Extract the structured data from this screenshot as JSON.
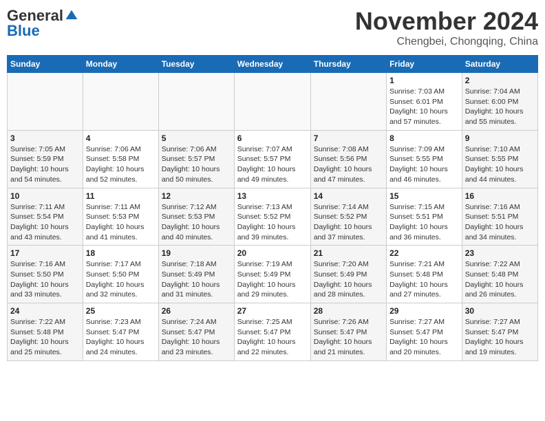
{
  "header": {
    "logo_general": "General",
    "logo_blue": "Blue",
    "month_title": "November 2024",
    "location": "Chengbei, Chongqing, China"
  },
  "weekdays": [
    "Sunday",
    "Monday",
    "Tuesday",
    "Wednesday",
    "Thursday",
    "Friday",
    "Saturday"
  ],
  "weeks": [
    {
      "days": [
        {
          "num": "",
          "info": ""
        },
        {
          "num": "",
          "info": ""
        },
        {
          "num": "",
          "info": ""
        },
        {
          "num": "",
          "info": ""
        },
        {
          "num": "",
          "info": ""
        },
        {
          "num": "1",
          "info": "Sunrise: 7:03 AM\nSunset: 6:01 PM\nDaylight: 10 hours and 57 minutes."
        },
        {
          "num": "2",
          "info": "Sunrise: 7:04 AM\nSunset: 6:00 PM\nDaylight: 10 hours and 55 minutes."
        }
      ]
    },
    {
      "days": [
        {
          "num": "3",
          "info": "Sunrise: 7:05 AM\nSunset: 5:59 PM\nDaylight: 10 hours and 54 minutes."
        },
        {
          "num": "4",
          "info": "Sunrise: 7:06 AM\nSunset: 5:58 PM\nDaylight: 10 hours and 52 minutes."
        },
        {
          "num": "5",
          "info": "Sunrise: 7:06 AM\nSunset: 5:57 PM\nDaylight: 10 hours and 50 minutes."
        },
        {
          "num": "6",
          "info": "Sunrise: 7:07 AM\nSunset: 5:57 PM\nDaylight: 10 hours and 49 minutes."
        },
        {
          "num": "7",
          "info": "Sunrise: 7:08 AM\nSunset: 5:56 PM\nDaylight: 10 hours and 47 minutes."
        },
        {
          "num": "8",
          "info": "Sunrise: 7:09 AM\nSunset: 5:55 PM\nDaylight: 10 hours and 46 minutes."
        },
        {
          "num": "9",
          "info": "Sunrise: 7:10 AM\nSunset: 5:55 PM\nDaylight: 10 hours and 44 minutes."
        }
      ]
    },
    {
      "days": [
        {
          "num": "10",
          "info": "Sunrise: 7:11 AM\nSunset: 5:54 PM\nDaylight: 10 hours and 43 minutes."
        },
        {
          "num": "11",
          "info": "Sunrise: 7:11 AM\nSunset: 5:53 PM\nDaylight: 10 hours and 41 minutes."
        },
        {
          "num": "12",
          "info": "Sunrise: 7:12 AM\nSunset: 5:53 PM\nDaylight: 10 hours and 40 minutes."
        },
        {
          "num": "13",
          "info": "Sunrise: 7:13 AM\nSunset: 5:52 PM\nDaylight: 10 hours and 39 minutes."
        },
        {
          "num": "14",
          "info": "Sunrise: 7:14 AM\nSunset: 5:52 PM\nDaylight: 10 hours and 37 minutes."
        },
        {
          "num": "15",
          "info": "Sunrise: 7:15 AM\nSunset: 5:51 PM\nDaylight: 10 hours and 36 minutes."
        },
        {
          "num": "16",
          "info": "Sunrise: 7:16 AM\nSunset: 5:51 PM\nDaylight: 10 hours and 34 minutes."
        }
      ]
    },
    {
      "days": [
        {
          "num": "17",
          "info": "Sunrise: 7:16 AM\nSunset: 5:50 PM\nDaylight: 10 hours and 33 minutes."
        },
        {
          "num": "18",
          "info": "Sunrise: 7:17 AM\nSunset: 5:50 PM\nDaylight: 10 hours and 32 minutes."
        },
        {
          "num": "19",
          "info": "Sunrise: 7:18 AM\nSunset: 5:49 PM\nDaylight: 10 hours and 31 minutes."
        },
        {
          "num": "20",
          "info": "Sunrise: 7:19 AM\nSunset: 5:49 PM\nDaylight: 10 hours and 29 minutes."
        },
        {
          "num": "21",
          "info": "Sunrise: 7:20 AM\nSunset: 5:49 PM\nDaylight: 10 hours and 28 minutes."
        },
        {
          "num": "22",
          "info": "Sunrise: 7:21 AM\nSunset: 5:48 PM\nDaylight: 10 hours and 27 minutes."
        },
        {
          "num": "23",
          "info": "Sunrise: 7:22 AM\nSunset: 5:48 PM\nDaylight: 10 hours and 26 minutes."
        }
      ]
    },
    {
      "days": [
        {
          "num": "24",
          "info": "Sunrise: 7:22 AM\nSunset: 5:48 PM\nDaylight: 10 hours and 25 minutes."
        },
        {
          "num": "25",
          "info": "Sunrise: 7:23 AM\nSunset: 5:47 PM\nDaylight: 10 hours and 24 minutes."
        },
        {
          "num": "26",
          "info": "Sunrise: 7:24 AM\nSunset: 5:47 PM\nDaylight: 10 hours and 23 minutes."
        },
        {
          "num": "27",
          "info": "Sunrise: 7:25 AM\nSunset: 5:47 PM\nDaylight: 10 hours and 22 minutes."
        },
        {
          "num": "28",
          "info": "Sunrise: 7:26 AM\nSunset: 5:47 PM\nDaylight: 10 hours and 21 minutes."
        },
        {
          "num": "29",
          "info": "Sunrise: 7:27 AM\nSunset: 5:47 PM\nDaylight: 10 hours and 20 minutes."
        },
        {
          "num": "30",
          "info": "Sunrise: 7:27 AM\nSunset: 5:47 PM\nDaylight: 10 hours and 19 minutes."
        }
      ]
    }
  ]
}
